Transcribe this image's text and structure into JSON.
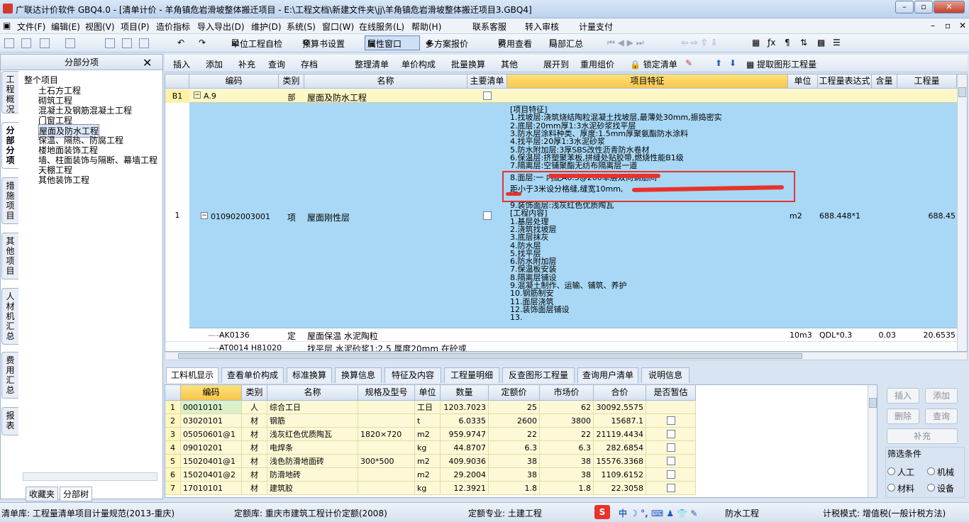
{
  "window": {
    "title": "广联达计价软件 GBQ4.0 - [清单计价 - 羊角镇危岩滑坡整体搬迁项目 - E:\\工程文档\\新建文件夹\\jj\\羊角镇危岩滑坡整体搬迁项目3.GBQ4]"
  },
  "menu": [
    "文件(F)",
    "编辑(E)",
    "视图(V)",
    "项目(P)",
    "造价指标",
    "导入导出(D)",
    "维护(D)",
    "系统(S)",
    "窗口(W)",
    "在线服务(L)",
    "帮助(H)",
    "联系客服",
    "转入审核",
    "计量支付"
  ],
  "toolbar": {
    "check": "单位工程自检",
    "budget": "预算书设置",
    "attr": "属性窗口",
    "multi": "多方案报价",
    "fee": "费用查看",
    "local": "局部汇总"
  },
  "left": {
    "header": "分部分项",
    "tabs": [
      "工程概况",
      "分部分项",
      "措施项目",
      "其他项目",
      "人材机汇总",
      "费用汇总",
      "报表"
    ],
    "bottom_tabs": [
      "收藏夹",
      "分部树"
    ],
    "tree": [
      "整个项目",
      "土石方工程",
      "砌筑工程",
      "混凝土及钢筋混凝土工程",
      "门窗工程",
      "屋面及防水工程",
      "保温、隔热、防腐工程",
      "楼地面装饰工程",
      "墙、柱面装饰与隔断、幕墙工程",
      "天棚工程",
      "其他装饰工程"
    ]
  },
  "toolbar2": [
    "插入",
    "添加",
    "补充",
    "查询",
    "存档",
    "整理清单",
    "单价构成",
    "批量换算",
    "其他",
    "展开到",
    "重用组价",
    "锁定清单",
    "提取图形工程量"
  ],
  "grid": {
    "headers": [
      "编码",
      "类别",
      "名称",
      "主要清单",
      "项目特征",
      "单位",
      "工程量表达式",
      "含量",
      "工程量"
    ],
    "rowB1": {
      "no": "B1",
      "code": "A.9",
      "type": "部",
      "name": "屋面及防水工程"
    },
    "row1": {
      "no": "1",
      "code": "010902003001",
      "type": "项",
      "name": "屋面刚性层",
      "unit": "m2",
      "expr": "688.448*1",
      "qty": "688.45"
    },
    "features": [
      "[项目特征]",
      "1.找坡层:浇筑烧结陶粒混凝土找坡层,最薄处30mm,振捣密实",
      "2.底层:20mm厚1:3水泥砂浆找平层",
      "3.防水层涂料种类、厚度:1.5mm厚聚氨酯防水涂料",
      "4.找平层:20厚1:3水泥砂浆",
      "5.防水附加层:3厚SBS改性沥青防水卷材",
      "6.保温层:挤塑聚苯板,拼缝处贴胶带,燃烧性能B1级",
      "7.隔离层:空铺聚酯无纺布隔离层一道",
      "8.面层:一 内配A6.5@200单层双向钢筋间",
      "距小于3米设分格缝,缝宽10mm,",
      "9.装饰面层:浅灰红色优质陶瓦",
      "[工程内容]",
      "1.基层处理",
      "2.浇筑找坡层",
      "3.底层抹灰",
      "4.防水层",
      "5.找平层",
      "6.防水附加层",
      "7.保温板安装",
      "8.隔离层铺设",
      "9.混凝土制作、运输、铺筑、养护",
      "10.钢筋制安",
      "11.面层浇筑",
      "12.装饰面层铺设",
      "13."
    ],
    "row2": {
      "code": "AK0136",
      "type": "定",
      "name": "屋面保温 水泥陶粒",
      "unit": "10m3",
      "expr": "QDL*0.3",
      "content": "0.03",
      "qty": "20.6535"
    },
    "row3": {
      "code": "AT0014 H81020",
      "name": "找平层 水泥砂浆1:2.5 厚度20mm 在砼或"
    }
  },
  "bottom_tabs": [
    "工料机显示",
    "查看单价构成",
    "标准换算",
    "换算信息",
    "特征及内容",
    "工程量明细",
    "反查图形工程量",
    "查询用户清单",
    "说明信息"
  ],
  "sub": {
    "headers": [
      "编码",
      "类别",
      "名称",
      "规格及型号",
      "单位",
      "数量",
      "定额价",
      "市场价",
      "合价",
      "是否暂估"
    ],
    "rows": [
      [
        "1",
        "00010101",
        "人",
        "综合工日",
        "",
        "工日",
        "1203.7023",
        "25",
        "62",
        "30092.5575"
      ],
      [
        "2",
        "03020101",
        "材",
        "钢筋",
        "",
        "t",
        "6.0335",
        "2600",
        "3800",
        "15687.1"
      ],
      [
        "3",
        "05050601@1",
        "材",
        "浅灰红色优质陶瓦",
        "1820×720",
        "m2",
        "959.9747",
        "22",
        "22",
        "21119.4434"
      ],
      [
        "4",
        "09010201",
        "材",
        "电焊条",
        "",
        "kg",
        "44.8707",
        "6.3",
        "6.3",
        "282.6854"
      ],
      [
        "5",
        "15020401@1",
        "材",
        "浅色防滑地面砖",
        "300*500",
        "m2",
        "409.9036",
        "38",
        "38",
        "15576.3368"
      ],
      [
        "6",
        "15020401@2",
        "材",
        "防滑地砖",
        "",
        "m2",
        "29.2004",
        "38",
        "38",
        "1109.6152"
      ],
      [
        "7",
        "17010101",
        "材",
        "建筑胶",
        "",
        "kg",
        "12.3921",
        "1.8",
        "1.8",
        "22.3058"
      ]
    ]
  },
  "right_buttons": [
    "插入",
    "添加",
    "删除",
    "查询",
    "补充"
  ],
  "filter": {
    "title": "筛选条件",
    "opts": [
      "人工",
      "机械",
      "材料",
      "设备"
    ]
  },
  "status": {
    "lib": "清单库: 工程量清单项目计量规范(2013-重庆)",
    "quota": "定额库: 重庆市建筑工程计价定额(2008)",
    "major": "定额专业: 土建工程",
    "waterproof": "防水工程",
    "mode": "计税模式: 增值税(一般计税方法)"
  }
}
